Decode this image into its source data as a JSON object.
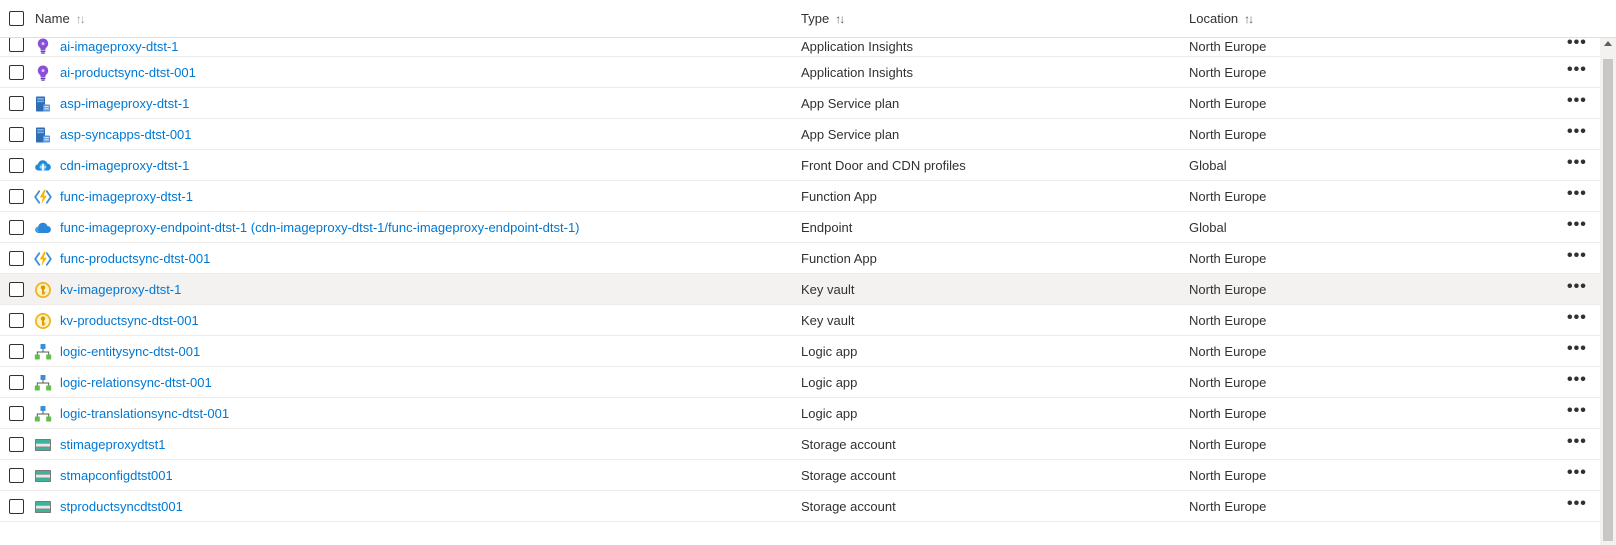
{
  "header": {
    "name_label": "Name",
    "type_label": "Type",
    "location_label": "Location",
    "sort_icon": "↑↓"
  },
  "rows": [
    {
      "name": "ai-imageproxy-dtst-1",
      "type": "Application Insights",
      "location": "North Europe",
      "icon": "app-insights-icon"
    },
    {
      "name": "ai-productsync-dtst-001",
      "type": "Application Insights",
      "location": "North Europe",
      "icon": "app-insights-icon"
    },
    {
      "name": "asp-imageproxy-dtst-1",
      "type": "App Service plan",
      "location": "North Europe",
      "icon": "app-service-plan-icon"
    },
    {
      "name": "asp-syncapps-dtst-001",
      "type": "App Service plan",
      "location": "North Europe",
      "icon": "app-service-plan-icon"
    },
    {
      "name": "cdn-imageproxy-dtst-1",
      "type": "Front Door and CDN profiles",
      "location": "Global",
      "icon": "cdn-profile-icon"
    },
    {
      "name": "func-imageproxy-dtst-1",
      "type": "Function App",
      "location": "North Europe",
      "icon": "function-app-icon"
    },
    {
      "name": "func-imageproxy-endpoint-dtst-1 (cdn-imageproxy-dtst-1/func-imageproxy-endpoint-dtst-1)",
      "type": "Endpoint",
      "location": "Global",
      "icon": "endpoint-cloud-icon"
    },
    {
      "name": "func-productsync-dtst-001",
      "type": "Function App",
      "location": "North Europe",
      "icon": "function-app-icon"
    },
    {
      "name": "kv-imageproxy-dtst-1",
      "type": "Key vault",
      "location": "North Europe",
      "icon": "key-vault-icon"
    },
    {
      "name": "kv-productsync-dtst-001",
      "type": "Key vault",
      "location": "North Europe",
      "icon": "key-vault-icon"
    },
    {
      "name": "logic-entitysync-dtst-001",
      "type": "Logic app",
      "location": "North Europe",
      "icon": "logic-app-icon"
    },
    {
      "name": "logic-relationsync-dtst-001",
      "type": "Logic app",
      "location": "North Europe",
      "icon": "logic-app-icon"
    },
    {
      "name": "logic-translationsync-dtst-001",
      "type": "Logic app",
      "location": "North Europe",
      "icon": "logic-app-icon"
    },
    {
      "name": "stimageproxydtst1",
      "type": "Storage account",
      "location": "North Europe",
      "icon": "storage-account-icon"
    },
    {
      "name": "stmapconfigdtst001",
      "type": "Storage account",
      "location": "North Europe",
      "icon": "storage-account-icon"
    },
    {
      "name": "stproductsyncdtst001",
      "type": "Storage account",
      "location": "North Europe",
      "icon": "storage-account-icon"
    }
  ],
  "more_label": "•••",
  "colors": {
    "link": "#0078d4",
    "text": "#323130",
    "selected_row": "#f3f2f1",
    "border": "#edebe9"
  }
}
